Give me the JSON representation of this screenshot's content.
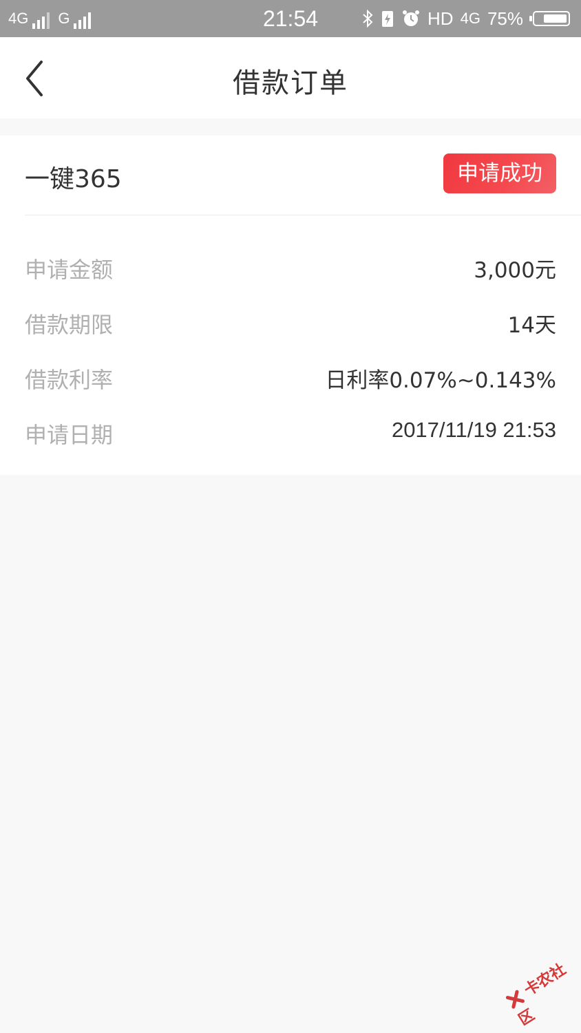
{
  "status_bar": {
    "net1": "4G",
    "net2": "G",
    "time": "21:54",
    "hd": "HD",
    "lte": "4G",
    "battery_text": "75%",
    "battery_level": 0.75
  },
  "header": {
    "title": "借款订单"
  },
  "order": {
    "product": "一键365",
    "status": "申请成功",
    "rows": [
      {
        "label": "申请金额",
        "value": "3,000元"
      },
      {
        "label": "借款期限",
        "value": "14天"
      },
      {
        "label": "借款利率",
        "value": "日利率0.07%~0.143%"
      },
      {
        "label": "申请日期",
        "value": "2017/11/19 21:53"
      }
    ]
  },
  "watermark": {
    "text": "卡农社区"
  },
  "colors": {
    "accent": "#f0383f",
    "status_bar": "#9b9b9b",
    "label": "#b0b0b0",
    "text": "#333333"
  }
}
